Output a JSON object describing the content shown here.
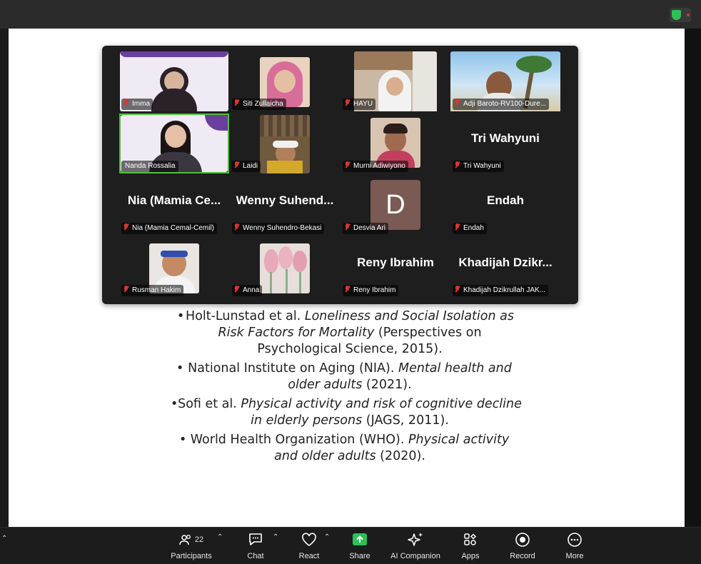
{
  "window": {
    "security_badge": "shield-check-icon"
  },
  "gallery": {
    "participants": [
      {
        "name": "Imma",
        "display": "",
        "muted": true,
        "video": true,
        "active": false
      },
      {
        "name": "Siti Zullaicha",
        "display": "",
        "muted": true,
        "video": true,
        "active": false
      },
      {
        "name": "HAYU",
        "display": "",
        "muted": true,
        "video": true,
        "active": false
      },
      {
        "name": "Adji Baroto-RV100-Dure...",
        "display": "",
        "muted": true,
        "video": true,
        "active": false
      },
      {
        "name": "Nanda Rossalia",
        "display": "",
        "muted": false,
        "video": true,
        "active": true
      },
      {
        "name": "Laidi",
        "display": "",
        "muted": true,
        "video": true,
        "active": false
      },
      {
        "name": "Murni Adiwiyono",
        "display": "",
        "muted": true,
        "video": true,
        "active": false
      },
      {
        "name": "Tri Wahyuni",
        "display": "Tri Wahyuni",
        "muted": true,
        "video": false,
        "active": false
      },
      {
        "name": "Nia (Mamia Cemal-Cemil)",
        "display": "Nia (Mamia Ce...",
        "muted": true,
        "video": false,
        "active": false
      },
      {
        "name": "Wenny Suhendro-Bekasi",
        "display": "Wenny Suhend...",
        "muted": true,
        "video": false,
        "active": false
      },
      {
        "name": "Desvia Ari",
        "display": "D",
        "muted": true,
        "video": false,
        "active": false
      },
      {
        "name": "Endah",
        "display": "Endah",
        "muted": true,
        "video": false,
        "active": false
      },
      {
        "name": "Rusman Hakim",
        "display": "",
        "muted": true,
        "video": true,
        "active": false
      },
      {
        "name": "Anna",
        "display": "",
        "muted": true,
        "video": true,
        "active": false
      },
      {
        "name": "Reny Ibrahim",
        "display": "Reny Ibrahim",
        "muted": true,
        "video": false,
        "active": false
      },
      {
        "name": "Khadijah Dzikrullah JAK...",
        "display": "Khadijah Dzikr...",
        "muted": true,
        "video": false,
        "active": false
      }
    ]
  },
  "slide": {
    "references": [
      {
        "plain": "Holt-Lunstad et al. ",
        "italic": "Loneliness and Social Isolation as Risk Factors for Mortality",
        "tail": " (Perspectives on Psychological Science, 2015)."
      },
      {
        "plain": "National Institute on Aging (NIA). ",
        "italic": "Mental health and older adults",
        "tail": " (2021)."
      },
      {
        "plain": "Sofi et al. ",
        "italic": "Physical activity and risk of cognitive decline in elderly persons",
        "tail": " (JAGS, 2011)."
      },
      {
        "plain": "World Health Organization (WHO). ",
        "italic": "Physical activity and older adults",
        "tail": " (2020)."
      }
    ]
  },
  "toolbar": {
    "participants_label": "Participants",
    "participants_count": "22",
    "chat_label": "Chat",
    "react_label": "React",
    "share_label": "Share",
    "ai_label": "AI Companion",
    "apps_label": "Apps",
    "record_label": "Record",
    "more_label": "More",
    "share_color": "#2fbf57"
  }
}
